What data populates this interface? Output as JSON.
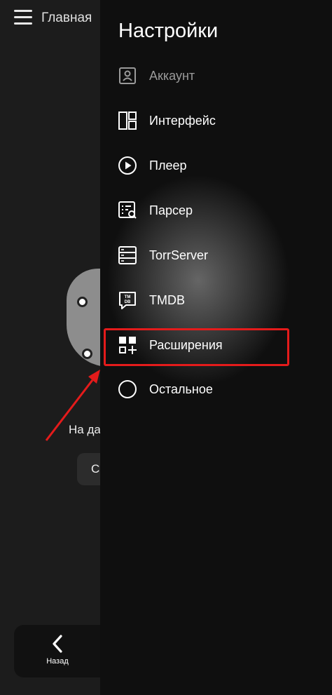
{
  "background": {
    "header_title": "Главная",
    "empty_text": "На да",
    "cta_button": "Сі",
    "back_label": "Назад"
  },
  "drawer": {
    "title": "Настройки",
    "items": [
      {
        "label": "Аккаунт",
        "icon": "account-icon",
        "dimmed": true
      },
      {
        "label": "Интерфейс",
        "icon": "interface-icon"
      },
      {
        "label": "Плеер",
        "icon": "player-icon"
      },
      {
        "label": "Парсер",
        "icon": "parser-icon"
      },
      {
        "label": "TorrServer",
        "icon": "torrserver-icon"
      },
      {
        "label": "TMDB",
        "icon": "tmdb-icon"
      },
      {
        "label": "Расширения",
        "icon": "extensions-icon",
        "highlighted": true
      },
      {
        "label": "Остальное",
        "icon": "other-icon"
      }
    ],
    "tmdb_badge": "TM DB"
  },
  "colors": {
    "drawer_bg": "#0f0f0f",
    "highlight": "#e41b1b",
    "dim_text": "#9a9a9a"
  }
}
